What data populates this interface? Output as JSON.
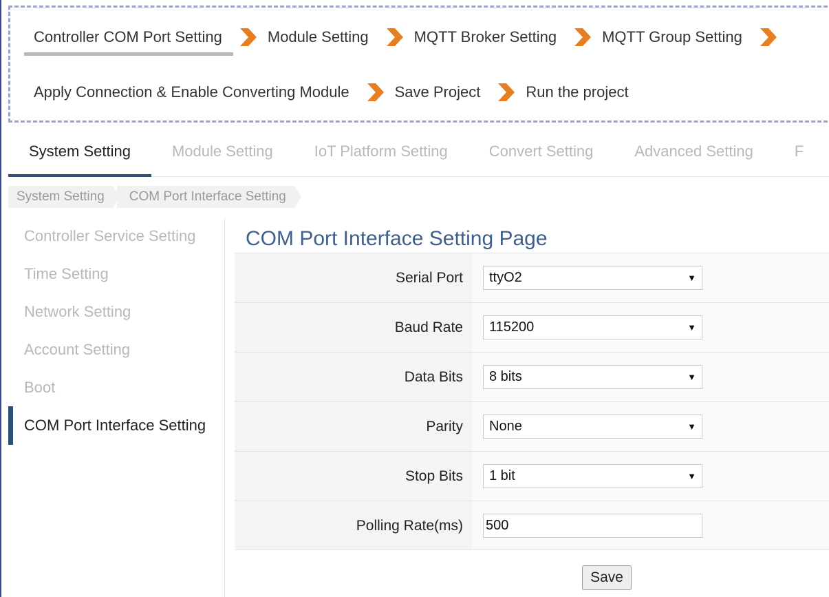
{
  "wizard": {
    "row1": [
      "Controller COM Port Setting",
      "Module Setting",
      "MQTT Broker Setting",
      "MQTT Group Setting"
    ],
    "row2": [
      "Apply Connection & Enable Converting Module",
      "Save Project",
      "Run the project"
    ],
    "active_step": "Controller COM Port Setting",
    "arrow_color": "#e67e22"
  },
  "tabs": [
    "System Setting",
    "Module Setting",
    "IoT Platform Setting",
    "Convert Setting",
    "Advanced Setting",
    "F"
  ],
  "active_tab": "System Setting",
  "breadcrumb": [
    "System Setting",
    "COM Port Interface Setting"
  ],
  "sidebar": {
    "items": [
      "Controller Service Setting",
      "Time Setting",
      "Network Setting",
      "Account Setting",
      "Boot",
      "COM Port Interface Setting"
    ],
    "active": "COM Port Interface Setting"
  },
  "page_title": "COM Port Interface Setting Page",
  "form": {
    "serial_port": {
      "label": "Serial Port",
      "value": "ttyO2"
    },
    "baud_rate": {
      "label": "Baud Rate",
      "value": "115200"
    },
    "data_bits": {
      "label": "Data Bits",
      "value": "8 bits"
    },
    "parity": {
      "label": "Parity",
      "value": "None"
    },
    "stop_bits": {
      "label": "Stop Bits",
      "value": "1 bit"
    },
    "polling_rate": {
      "label": "Polling Rate(ms)",
      "value": "500"
    }
  },
  "save_label": "Save",
  "colors": {
    "accent": "#2e4f7a",
    "title": "#3e5f8a",
    "arrow": "#e67e22"
  }
}
